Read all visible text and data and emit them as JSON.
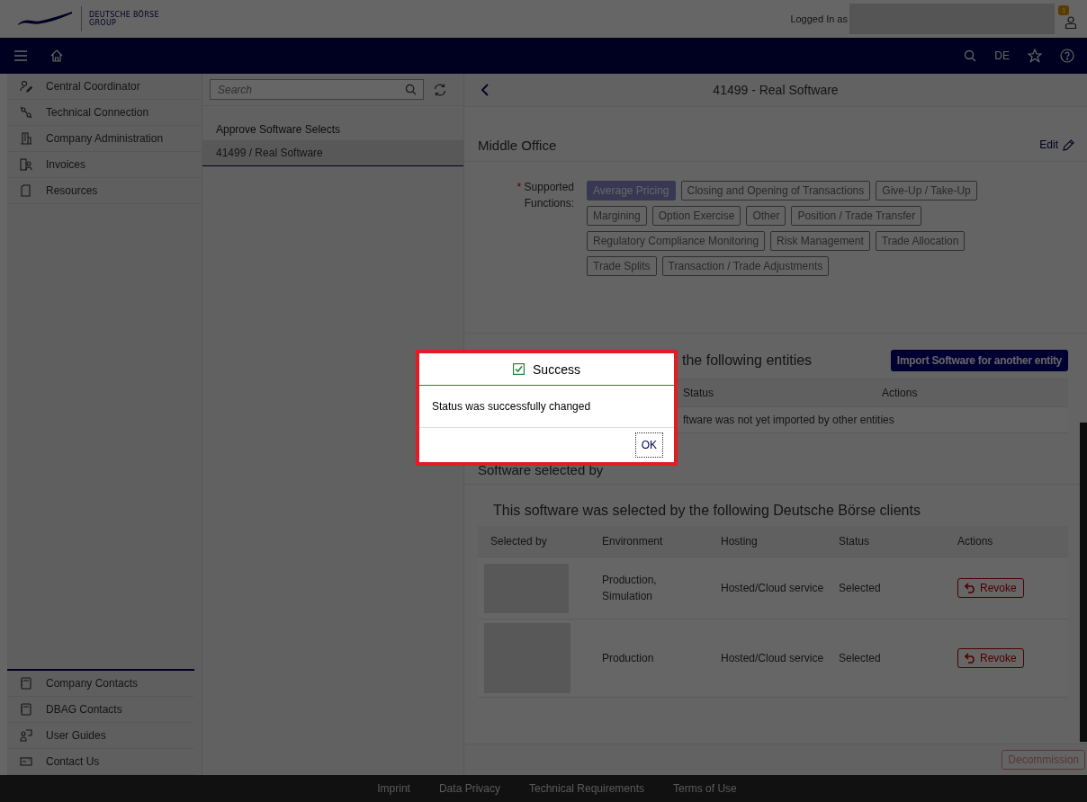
{
  "header": {
    "logo_line1": "DEUTSCHE BÖRSE",
    "logo_line2": "GROUP",
    "logged_in_label": "Logged In as",
    "notification_count": "1"
  },
  "navbar": {
    "language": "DE"
  },
  "sidebar": {
    "items": [
      {
        "label": "Central Coordinator"
      },
      {
        "label": "Technical Connection"
      },
      {
        "label": "Company Administration"
      },
      {
        "label": "Invoices"
      },
      {
        "label": "Resources"
      }
    ],
    "bottom_items": [
      {
        "label": "Company Contacts"
      },
      {
        "label": "DBAG Contacts"
      },
      {
        "label": "User Guides"
      },
      {
        "label": "Contact Us"
      }
    ]
  },
  "list_panel": {
    "search": {
      "placeholder": "Search"
    },
    "group_title": "Approve Software Selects",
    "items": [
      {
        "label": "41499 / Real Software",
        "selected": true
      }
    ]
  },
  "detail": {
    "title": "41499 - Real Software",
    "middle_office": {
      "title": "Middle Office",
      "edit_label": "Edit",
      "field_label": "Supported Functions:",
      "required_mark": "*",
      "functions": [
        {
          "label": "Average Pricing",
          "selected": true
        },
        {
          "label": "Closing and Opening of Transactions",
          "selected": false
        },
        {
          "label": "Give-Up / Take-Up",
          "selected": false
        },
        {
          "label": "Margining",
          "selected": false
        },
        {
          "label": "Option Exercise",
          "selected": false
        },
        {
          "label": "Other",
          "selected": false
        },
        {
          "label": "Position / Trade Transfer",
          "selected": false
        },
        {
          "label": "Regulatory Compliance Monitoring",
          "selected": false
        },
        {
          "label": "Risk Management",
          "selected": false
        },
        {
          "label": "Trade Allocation",
          "selected": false
        },
        {
          "label": "Trade Splits",
          "selected": false
        },
        {
          "label": "Transaction / Trade Adjustments",
          "selected": false
        }
      ]
    },
    "imported": {
      "subtitle": "the following entities",
      "import_button": "Import Software for another entity",
      "columns": [
        "Status",
        "Actions"
      ],
      "empty_message": "ftware was not yet imported by other entities"
    },
    "selected_by": {
      "title": "Software selected by",
      "subtitle": "This software was selected by the following Deutsche Börse clients",
      "columns": [
        "Selected by",
        "Environment",
        "Hosting",
        "Status",
        "Actions"
      ],
      "rows": [
        {
          "environment": "Production, Simulation",
          "hosting": "Hosted/Cloud service",
          "status": "Selected",
          "action": "Revoke"
        },
        {
          "environment": "Production",
          "hosting": "Hosted/Cloud service",
          "status": "Selected",
          "action": "Revoke"
        }
      ]
    },
    "decommission_button": {
      "label": "Decommission",
      "disabled": true
    }
  },
  "footer": {
    "links": [
      "Imprint",
      "Data Privacy",
      "Technical Requirements",
      "Terms of Use"
    ]
  },
  "dialog": {
    "title": "Success",
    "message": "Status was successfully changed",
    "ok_button": "OK"
  }
}
